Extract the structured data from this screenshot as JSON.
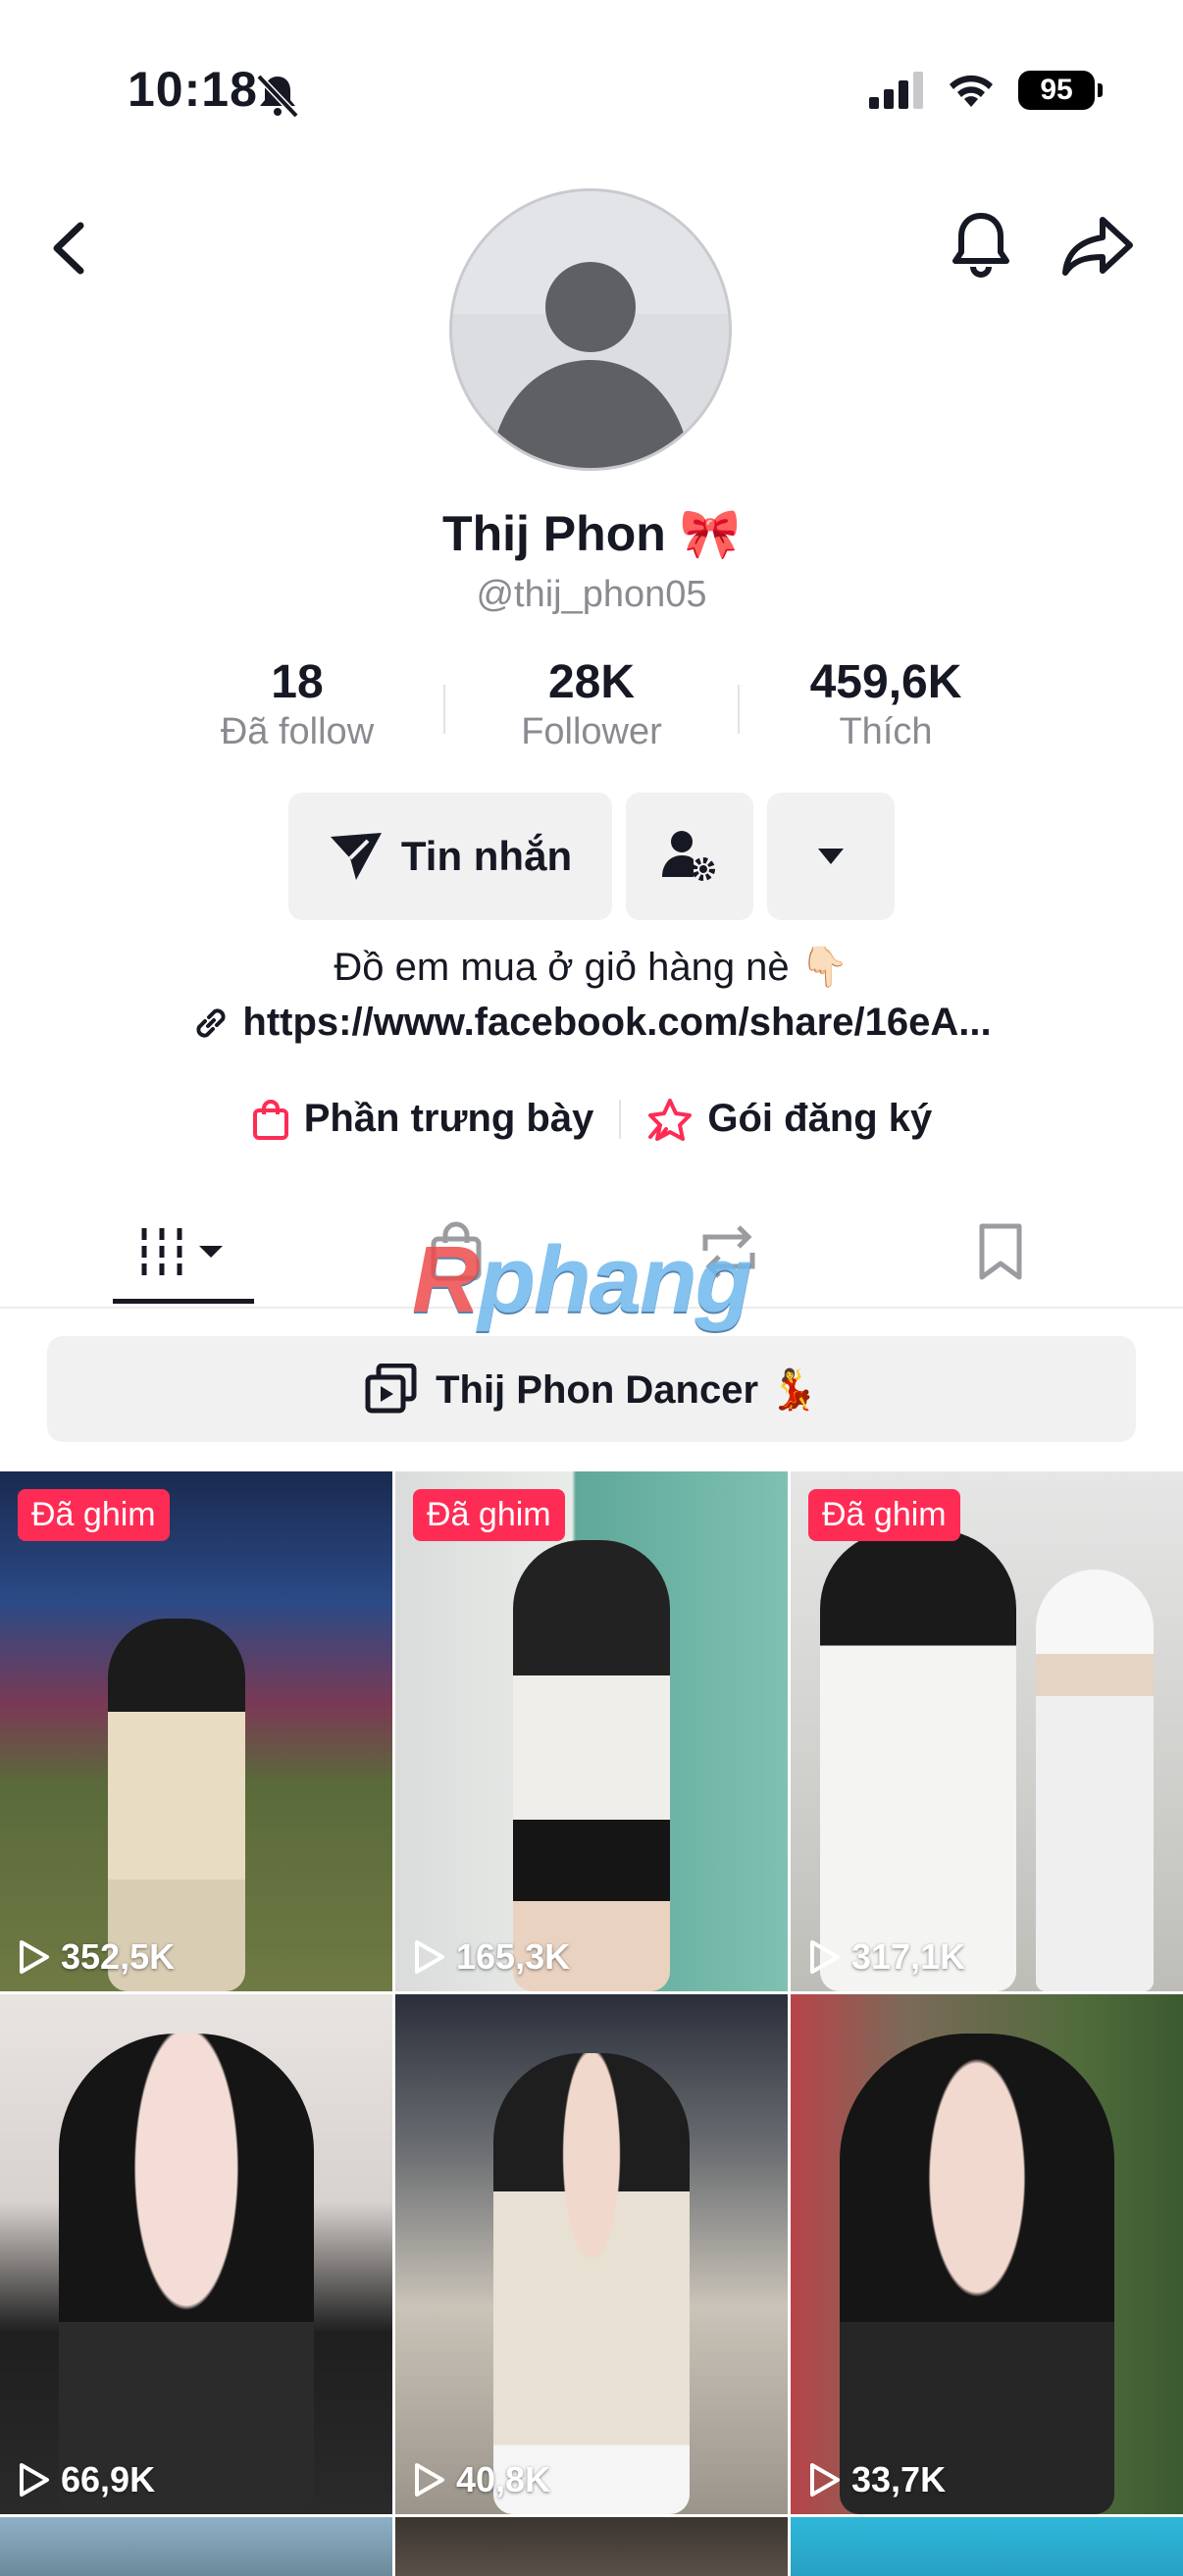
{
  "status_bar": {
    "time": "10:18",
    "battery": "95"
  },
  "profile": {
    "display_name": "Thij Phon 🎀",
    "username": "@thij_phon05",
    "stats": [
      {
        "value": "18",
        "label": "Đã follow"
      },
      {
        "value": "28K",
        "label": "Follower"
      },
      {
        "value": "459,6K",
        "label": "Thích"
      }
    ],
    "message_button": "Tin nhắn",
    "bio": "Đồ em mua ở giỏ hàng  nè 👇🏻",
    "link": "https://www.facebook.com/share/16eA..."
  },
  "features": {
    "showcase": "Phần trưng bày",
    "subscription": "Gói đăng ký"
  },
  "watermark": {
    "r": "R",
    "rest": "phang"
  },
  "playlist": {
    "title": "Thij Phon Dancer 💃"
  },
  "videos": [
    {
      "pinned": "Đã ghim",
      "views": "352,5K"
    },
    {
      "pinned": "Đã ghim",
      "views": "165,3K"
    },
    {
      "pinned": "Đã ghim",
      "views": "317,1K"
    },
    {
      "pinned": "",
      "views": "66,9K"
    },
    {
      "pinned": "",
      "views": "40,8K"
    },
    {
      "pinned": "",
      "views": "33,7K"
    }
  ],
  "colors": {
    "accent": "#fe2c55",
    "text": "#161823",
    "muted": "#8a8b91",
    "button_bg": "#f1f1f2"
  }
}
